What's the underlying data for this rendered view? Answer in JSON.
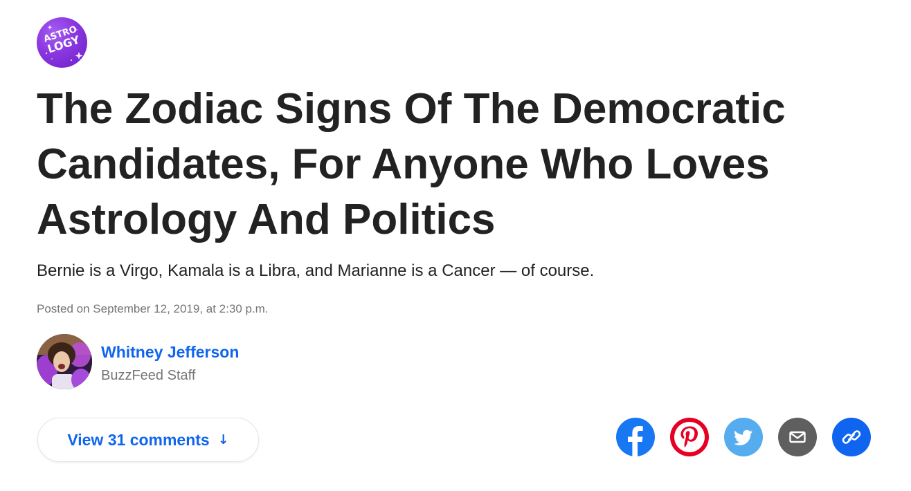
{
  "badge": {
    "line1": "ASTRO",
    "line2": "LOGY",
    "color": "#8a36e0"
  },
  "article": {
    "title": "The Zodiac Signs Of The Democratic Candidates, For Anyone Who Loves Astrology And Politics",
    "description": "Bernie is a Virgo, Kamala is a Libra, and Marianne is a Cancer — of course.",
    "posted": "Posted on September 12, 2019, at 2:30 p.m."
  },
  "author": {
    "name": "Whitney Jefferson",
    "role": "BuzzFeed Staff",
    "avatar_icon": "author-avatar"
  },
  "comments": {
    "label": "View 31 comments",
    "arrow": "↓"
  },
  "share": [
    {
      "name": "facebook",
      "icon": "facebook-icon",
      "color": "#1877f2"
    },
    {
      "name": "pinterest",
      "icon": "pinterest-icon",
      "color": "#e60023"
    },
    {
      "name": "twitter",
      "icon": "twitter-icon",
      "color": "#55acee"
    },
    {
      "name": "email",
      "icon": "email-icon",
      "color": "#5f5f5f"
    },
    {
      "name": "copy-link",
      "icon": "link-icon",
      "color": "#0f65ef"
    }
  ],
  "colors": {
    "link_blue": "#0f65ef",
    "text": "#222222",
    "muted": "#757575"
  }
}
